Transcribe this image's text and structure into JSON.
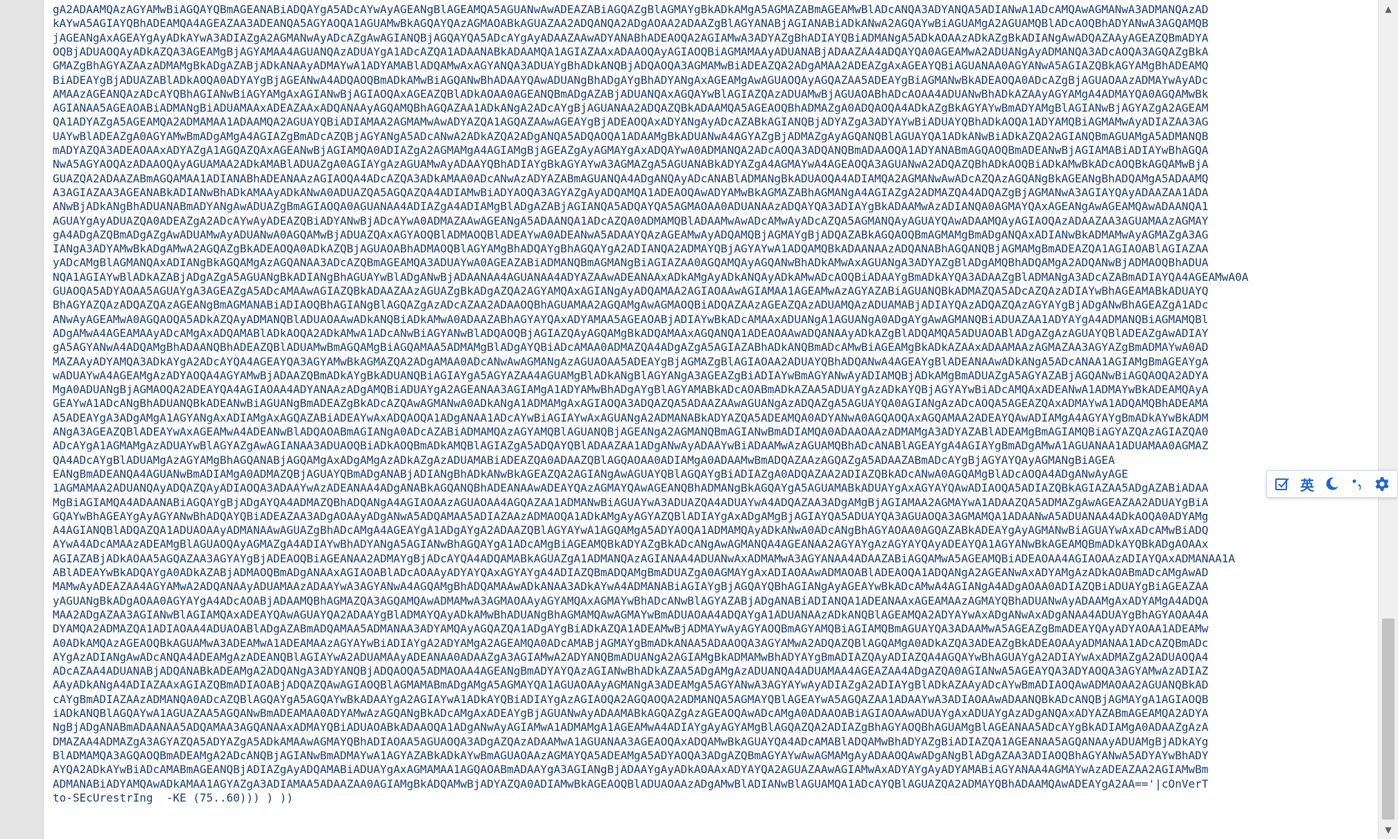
{
  "editor": {
    "lines": [
      "gA2ADAAMQAzAGYAMwBiAGQAYQBmAGEANABiADQAYgA5ADcAYwAyAGEANgBlAGEAMQA5AGUANwAwADEAZABiAGQAZgBlAGMAYgBkADkAMgA5AGMAZABmAGEAMwBlADcANQA3ADYANQA5ADIANwA1ADcAMQAwAGMANwA3ADMANQAzAD",
      "kAYwA5AGIAYQBhADEAMQA4AGEAZAA3ADEANQA5AGYAOQA1AGUAMwBkAGQAYQAzAGMAOABkAGUAZAA2ADQANQA2ADgAOAA2ADAAZgBlAGYANABjAGIANABiADkANwA2AGQAYwBiAGUAMgA2AGUAMQBlADcAOQBhADYANwA3AGQAMQB",
      "jAGEANgAxAGEAYgAyADkAYwA3ADIAZgA2AGMANwAyADcAZgAwAGIANQBjAGQAYQA5ADcAYgAyADAAZAAwADYANABhADEAOQA2AGIAMwA3ADYAZgBhADIAYQBiADMANgA5ADkAOAAzADkAZgBkADIANgAwADQAZAAyAGEAZQBmADYA",
      "OQBjADUAOQAyADkAZQA3AGEAMgBjAGYAMAA4AGUANQAzADUAYgA1ADcAZQA1ADAANABkADAAMQA1AGIAZAAxADAAOQAyAGIAOQBiAGMAMAAyADUANABjADAAZAA4ADQAYQA0AGEAMwA2ADUANgAyADMANQA3ADcAOQA3AGQAZgBkA",
      "GMAZgBhAGYAZAAzADMAMgBkADgAZABjADkANAAyADMAYwA1ADYAMABlADQAMwAxAGYANQA3ADUAYgBhADkANQBjADQAOQA3AGMAMwBiADEAZQA2ADgAMAA2ADEAZgAxAGEAYQBiAGUANAA0AGYANwA5AGIAZQBkAGYAMgBhADEAMQ",
      "BiADEAYgBjADUAZABlADkAOQA0ADYAYgBjAGEANwA4ADQAOQBmADkAMwBiAGQANwBhADAAYQAwADUANgBhADgAYgBhADYANgAxAGEAMgAwAGUAOQAyAGQAZAA5ADEAYgBiAGMANwBkADEAOQA0ADcAZgBjAGUAOAAzADMAYwAyADc",
      "AMAAzAGEANQAzADcAYQBhAGIANwBiAGYAMgAxAGIANwBjAGIAOQAxAGEAZQBlADkAOAA0AGEANQBmADgAZABjADUANQAxAGQAYwBlAGIAZQAzADUAMwBjAGUAOABhADcAOAA4ADUANwBhADkAZAAyAGYAMgA4ADMAYQA0AGQAMwBk",
      "AGIANAA5AGEAOABiADMANgBiADUAMAAxADEAZAAxADQANAAyAGQAMQBhAGQAZAA1ADkANgA2ADcAYgBjAGUANAA2ADQAZQBkADAAMQA5AGEAOQBhADMAZgA0ADQAOQA4ADkAZgBkAGYAYwBmADYAMgBlAGIANwBjAGYAZgA2AGEAM",
      "QA1ADYAZgA5AGEAMQA2ADMAMAA1ADAAMQA2AGUAYQBiADIAMAA2AGMAMwAwADYAZQA1AGQAZAAwAGEAYgBjADEAOQAxADYANgAyADcAZABkAGIANQBjADYAZgA3ADYAYwBiADUAYQBhADkAOQA1ADYAMQBiAGMAMwAyADIAZAA3AG",
      "UAYwBlADEAZgA0AGYAMwBmADgAMgA4AGIAZgBmADcAZQBjAGYANgA5ADcANwA2ADkAZQA2ADgANQA5ADQAOQA1ADAAMgBkADUANwA4AGYAZgBjADMAZgAyAGQANQBlAGUAYQA1ADkANwBiADkAZQA2AGIANQBmAGUAMgA5ADMANQB",
      "mADYAZQA3ADEAOAAxADYAZgA1AGQAZQAxAGEANwBjAGIAMQA0ADIAZgA2AGMAMgA4AGIAMgBjAGEAZgAyAGMAYgAxADQAYwA0ADMANQA2ADcAOQA3ADQANQBmADAAOQA1ADYANABmAGQAOQBmADEANwBjAGIAMABiADIAYwBhAGQA",
      "NwA5AGYAOQAzADAAOQAyAGUAMAA2ADkAMABlADUAZgA0AGIAYgAzAGUAMwAyADAAYQBhADIAYgBkAGYAYwA3AGMAZgA5AGUANABkADYAZgA4AGMAYwA4AGEAOQA3AGUANwA2ADQAZQBhADkAOQBiADkAMwBkADcAOQBkAGQAMwBjA",
      "GUAZQA2ADAAZABmAGQAMAA1ADIANABhADEANAAzAGIAOQA4ADcAZQA3ADkAMAA0ADcANwAzADYAZABmAGUANQA4ADgANQAyADcANABlADMANgBkADUAOQA4ADIAMQA2AGMANwAwADcAZQAzAGQANgBkAGEANgBhADQAMgA5ADAAMQ",
      "A3AGIAZAA3AGEANABkADIANwBhADkAMAAyADkANwA0ADUAZQA5AGQAZQA4ADIAMwBiADYAOQA3AGYAZgAyADQAMQA1ADEAOQAwADYAMwBkAGMAZABhAGMANgA4AGIAZgA2ADMAZQA4ADQAZgBjAGMANwA3AGIAYQAyADAAZAA1ADA",
      "ANwBjADkANgBhADUANABmADYANgAwADUAZgBmAGIAOQA0AGUANAA4ADIAZgA4ADIAMgBlADgAZABjAGIANQA5ADQAYQA5AGMAOAA0ADUANAAzADQAYQA3ADIAYgBkADAAMwAzADIANQA0AGMAYQAxAGEANgAwAGEAMQAwADAANQA1",
      "AGUAYgAyADUAZQA0ADEAZgA2ADcAYwAyADEAZQBiADYANwBjADcAYwA0ADMAZAAwAGEANgA5ADAANQA1ADcAZQA0ADMAMQBlADAAMwAwADcAMwAyADcAZQA5AGMANQAyAGUAYQAwADAAMQAyAGIAOQAzADAAZAA3AGUAMAAzAGMAY",
      "gA4ADgAZQBmADgAZgAwADUAMwAyADUANwA0AGQAMwBjADUAZQAxAGYAOQBlADMAOQBlADEAYwA0ADEANwA5ADAAYQAzAGEAMwAyADQAMQBjAGMAYgBjADQAZABkAGQAOQBmAGMAMgBmADgANQAxADIANwBkADMAMwAyAGMAZgA3AG",
      "IANgA3ADYAMwBkADgAMwA2AGQAZgBkADEAOQA0ADkAZQBjAGUAOABhADMAOQBlAGYAMgBhADQAYgBhAGQAYgA2ADIANQA2ADMAYQBjAGYAYwA1ADQAMQBkADAANAAzADQANABhAGQANQBjAGMAMgBmADEAZQA1AGIAOABlAGIAZAA",
      "yADcAMgBlAGMANQAxADIANgBkAGQAMgAzAGQANAA3ADcAZQBmAGEAMQA3ADUAYwA0AGEAZABiADMANQBmAGMANgBiAGIAZAA0AGQAMQAyAGQANwBhADkAMwAxAGUANgA3ADYAZgBlADgAMQBhADQAMgA2ADQANwBjADMAOQBhADUA",
      "NQA1AGIAYwBlADkAZABjADgAZgA5AGUANgBkADIANgBhAGUAYwBlADgANwBjADAANAA4AGUANAA4ADYAZAAwADEANAAxADkAMgAyADkANQAyADkAMwADcAOQBiADAAYgBmADkAYQA3ADAAZgBlADMANgA3ADcAZABmADIAYQA4AGEAMwA0A",
      "GUAOQA5ADYAOAA5AGUAYgA3AGEAZgA5ADcAMAAwAGIAZQBkADAAZAAzAGUAZgBkADgAZQA2AGYAMQAxAGIANgAyADQAMAA2AGIAOAAwAGIAMAA1AGEAMwAzAGYAZABiAGUANQBkADMAZQA5ADcAZQAzADIAYwBhAGEAMABkADUAYQ",
      "BhAGYAZQAzADQAZQAzAGEANgBmAGMANABiADIAOQBhAGIANgBlAGQAZgAzADcAZAA2ADAAOQBhAGUAMAA2AGQAMgAwAGMAOQBiADQAZAAzAGEAZQAzADUAMQAzADUAMABjADIAYQAzADQAZQAzAGYAYgBjADgANwBhAGEAZgA1ADc",
      "ANwAyAGEAMwA0AGQAOQA5ADkAZQAyADMANQBlADUAOAAwADkANQBiADkAMwA0ADAAZABhAGYAYQAxADYAMAA5AGEAOABjADIAYwBkADcAMAAxADUANgA1AGUANgA0ADgAYgAwAGMANQBiADUAZAA1ADYAYgA4ADMANQBiAGMAMQBl",
      "ADgAMwA4AGEAMAAyADcAMgAxADQAMABlADkAOQA2ADkAMwA1ADcANwBiAGYANwBlADQAOQBjAGIAZQAyAGQAMgBkADQAMAAxAGQANQA1ADEAOAAwADQANAAyADkAZgBlADQAMQA5ADUAOABlADgAZgAzAGUAYQBlADEAZgAwADIAY",
      "gA5AGYANwA4ADQAMgBhADAANQBhADEAZQBlADUAMwBmAGQAMgBiAGQAMAA5ADMAMgBlADgAYQBiADcAMAA0ADMAZQA4ADgAZgA5AGIAZABhADkANQBmADcAMwBiAGEAMgBkADkAZAAxADAAMAAzAGMAZAA3AGYAZgBmADMAYwA0AD",
      "MAZAAyADYAMQA3ADkAYgA2ADcAYQA4AGEAYQA3AGYAMwBkAGMAZQA2ADgAMAA0ADcANwAwAGMANgAzAGUAOAA5ADEAYgBjAGMAZgBlAGIAOAA2ADUAYQBhADQANwA4AGEAYgBlADEANAAwADkANgA5ADcANAA1AGIAMgBmAGEAYgA",
      "wADUAYwA4AGEAMgAzADYAOQA4AGYAMwBjADAAZQBmADkAYgBkADUANQBiAGIAYgA5AGYAZAA4AGUAMgBlADkANgBlAGYANgA3AGEAZgBiADIAYwBmAGYANwAyADIAMQBjADkAMgBmADUAZgA5AGYAZABjAGQANwBiAGQAOQA2ADYA",
      "MgA0ADUANgBjAGMAOQA2ADEAYQA4AGIAOAA4ADYANAAzADgAMQBiADUAYgA2AGEANAA3AGIAMgA1ADYAMwBhADgAYgBlAGYAMABkADcAOABmADkAZAA5ADUAYgAzADkAYQBjAGYAYwBiADcAMQAxADEANwA1ADMAYwBkADEAMQAyA",
      "GEAYwA1ADcANgBhADUANQBkADEANwBiAGUANgBmADEAZgBkADcAZQAwAGMANwA0ADkANgA1ADMAMgAxAGIAOQA3ADQAZQA5ADAAZAAwAGUANgAzADQAZgA5AGUAYQA0AGIANgAzADcAOQA5AGEAZQAxADMAYwA1ADQAMQBhADEAMA",
      "A5ADEAYgA3ADgAMgA1AGYANgAxADIAMgAxAGQAZABiADEAYwAxADQAOQA1ADgANAA1ADcAYwBiAGIAYwAxAGUANgA2ADMANABkADYAZQA5ADEAMQA0ADYANwA0AGQAOQAxAGQAMAA2ADEAYQAwADIAMgA4AGYAYgBmADkAYwBkADM",
      "ANgA3AGEAZQBlADEAYwAxAGEAMwA4ADEANwBlADQAOABmAGIANgA0ADcAZABiADMAMQAzAGYAMQBlAGUANQBjAGEANgA2AGMANQBmAGIANwBmADIAMQA0ADAAOAAzADMAMgA3ADYAZABlADEAMgBmAGIAMQBiAGYAZQAzAGIAZQA0",
      "ADcAYgA1AGMAMgAzADUAYwBlAGYAZgAwAGIANAA3ADUAOQBiADkAOQBmADkAMQBlAGIAZgA5ADQAYQBlADAAZAA1ADgANwAyADAAYwBiADAAMwAzAGUAMQBhADcANABlAGEAYgA4AGIAYgBmADgAMwA1AGUANAA1ADUAMAA0AGMAZ",
      "QA4ADcAYgBlADUAMgAzAGYAMgBhAGQANABjAGQAMgAxADgAMgAzADkAZgAzADUAMABiADEAZQA0ADAAZQBlAGQAOAA0ADIAMgA0ADAAMwBmADQAZAAzAGQAZgA5ADAAZABmADcAYgBjAGYAYQAyAGMANgBiAGEA",
      "EANgBmADEANQA4AGUANwBmADIAMgA0ADMAZQBjAGUAYQBmADgANABjADIANgBhADkANwBkAGEAZQA2AGIANgAwAGUAYQBlAGQAYgBiADIAZgA0ADQAZAA2ADIAZQBkADcANwA0AGQAMgBlADcAOQA4ADgANwAyAGE",
      "1AGMAMAA2ADUANQAyADQAZQAyADIAOQA3ADAAYwAzADEANAA4ADgANABkAGQANQBhADEANAAwADEAYQAzAGMAYQAwAGEANQBhADMANgBkAGQAYgA5AGUAMABkADUAYgAxAGYAYQAwADIAOQA5ADIAZQBkAGIAZAA5ADgAZABiADAA",
      "MgBiAGIAMQA4ADAANABiAGQAYgBjADgAYQA4ADMAZQBhADQANgA4AGIAOAAzAGUAOAA4AGQAZAA1ADMANwBiAGUAYwA3ADUAZQA4ADUAYwA4ADQAZAA3ADgAMgBjAGIAMAA2AGMAYwA1ADAAZQA5ADMAZgAwAGEAZAA2ADUAYgBiA",
      "GQAYwBhAGEAYgAyAGYANwBhADQAYQBiADEAZAA3ADgAOAAyADgANwA5ADQAMAA5ADIAZAAzADMAOQA1ADkAMgAyAGYAZQBlADIAYgAxADgAMgBjAGIAYQA5ADUAYQA3AGUAOQA3AGMAMQA1ADAANwA5ADUANAA4ADkAOQA0ADYAMg",
      "A4AGIANQBlADQAZQA1ADUAOAAyADMANAAwAGUAZgBhADcAMgA4AGEAYgA1ADgAYgA2ADAAZQBlAGYAYwA1AGQAMgA5ADYAOQA1ADMAMQAyADkANwA0ADcANgBhAGYAOAA0AGQAZABkADEAYgAyAGMANwBiAGUAYwAxADcAMwBiADQ",
      "AYwA4ADcAMAAzADEAMgBlAGUAOQAyAGMAZgA4ADIAYwBhADYANgA5AGIANwBhAGQAYgA1ADcAMgBiAGEAMQBkADYAZgBkADcANgAwAGMANQA4AGEANAA2AGYAYgAzAGYAYQAyADEAYQA1AGYANwBkAGEAMQBmADkAYQBkADgAOAAx",
      "AGIAZABjADkAOAA5AGQAZAA3AGYAYgBjADEAOQBiAGEANAA2ADMAYgBjADcAYQA4ADQAMABkAGUAZgA1ADMANQAzAGIANAA4ADUANwAxADMAMwA3AGYANAA4ADAAZABiAGQAMwA5AGEAMQBiADEAOAA4AGIAOAAzADIAYQAxADMANAA1A",
      "ABlADEAYwBkADQAYgA0ADkAZABjADMAOQBmADgANAAxAGIAOABlADcAOAAyADYAYQAxAGYAYgA4ADIAZQBmADQAMgBmADUAZgA0AGMAYgAxADIAOAAwADMAOABlADEAOQA1ADQANgA2AGEANwAxADYAMgAzADkAOABmADcAMgAwAD",
      "MAMwAyADEAZAA4AGYAMwA2ADQANAAyADUAMAAzADAAYwA3AGYANwA4AGQAMgBhADQAMAAwADkANAA3ADkAYwA4ADMANABiAGIAYgBjAGQAYQBhAGIANgAyAGEAYwBkADcAMwA4AGIANgA4ADgAOAA0ADIAZQBiADUAYgBiAGEAZAA",
      "yAGUANgBkADgAOAA0AGYAYgA4ADcAOABjADAAMQBhAGMAZQA3AGQAMQAwADMAMwA3AGMAOAAyAGYAMQAxAGMAYwBhADcANwBlAGYAZABjADgANABiADIANQA1ADEANAAxAGEAMAAzAGMAYQBhADUANwAyADAAMgAxADYAMgA4ADQA",
      "MAA2ADgAZAA3AGIANwBlAGIAMQAxADEAYQAwAGUAYQA2ADAAYgBlADMAYQAyADkAMwBhADUANgBhAGMAMQAwAGMAYwBmADUAOAA4ADQAYgA1ADUANAAzADkANQBlAGEAMQA2ADYAYwAxADgANwAxADgANAA4ADUAYgBhAGYAOAA4A",
      "DYAMQA2ADMAZQA1ADIAOAA4ADUAOABlADgAZABmADQAMAA5ADMANAA3ADYAMQAyAGQAZQA1ADgAYgBiADkAZQA1ADEAMwBjADMAYwAyAGYAOQBmAGYAMQBiAGIAMQBmAGUAYQA3ADAAMwA5AGEAZgBmADEAYQAyADYAOAA1ADEAMw",
      "A0ADkAMQAzAGEAOQBkAGUAMwA3ADEAMwA1ADEAMAAzAGYAYwBiADIAYgA2ADYAMgA2AGEAMQA0ADcAMABjAGMAYgBmADkANAA5ADAAOQA3AGYAMwA2ADQAZQBlAGQAMgA0ADkAZQA3ADEAZgBkADEAOAAyADMANAA1ADcAZQBmADc",
      "AYgAzADIANgAwADcANQA4ADEAMgAzADEANQBlAGIAYwA2ADUAMAAyADEANAA0ADAAZgA3AGIAMwA2ADYANQBmADUANgA2AGIAMgBkADMAMwBhADYAYgBmADIAZQAyADIAZQA4AGQAYwBhAGUAYgA2ADIAYwAxADMAZgA2ADUAOQA4",
      "ADcAZAA4ADUANABjADQANABkADEAMgA2ADQANgA3ADYANQBjADQAOQA5ADMAOAA4AGEANgBmADYAYQAzAGIANwBhADkAZAA5ADgAMgAzADUANQA4ADUAMAA4AGEAZAA4ADgAZQA0AGIANwA5AGEAYQA3ADYAOQA3AGYAMwAzADIAZ",
      "AAyADkANgA4ADIAZAAxAGIAZQBmADIAOABjADQAZQAwAGIAOQBlAGMAMABmADgAMgA5AGMAYQA1AGUAOAAyAGMANgA3ADEAMgA5AGYANwA3AGYAYwAyADIAZgA2ADIAYgBlADkAZAAyADcAYwBmADIAOQAwADMAOAA2AGUANQBkAD",
      "cAYgBmADIAZAAzADMANQA0ADcAZQBlAGQAYgA5AGQAYwBkADAAYgA2AGIAYwA1ADkAYQBiADIAYgAzAGIAOQA2AGQAOQA2ADMANQA5AGMAYQBlAGEAYwA5AGQAZAA1ADAAYwA3ADIAOAAwADAANQBkADcANQBjAGMAYgA1AGIAOQB",
      "iADkANQBlAGQAYwA1AGUAZAA5AGQANwBmADEAMAA0ADYAMwAzAGQANgBkADcAMgAxADEAYgBjAGUANwAyADAAMABkAGQAZgAzAGEAOQAwADcAMgA0ADAAOABiAGIAOAAwADUAYgAxADUAYgAzADgANQAxADYAZABmAGEAMQA2ADYA",
      "NgBjADgANABmADAANAA5ADQAMAA3AGQANAAxADMAYQBiADUAOABkADAAOQA1ADgANwAyAGIAMwA1ADMAMgA1AGEAMwA4ADIAYgAyAGYAMgBlAGQAZQA2ADIAZgBhAGYAOQBhAGUAMgBlAGEANAA5ADcAYgBkADIAMgA0ADAAZgAzA",
      "DMAZAA4ADMAZgA3AGYAZQA5ADYAZgA5ADkAMAAwAGMAYQBhADIAOAA5AGUAOQA3ADgAZQAzADAAMwA1AGUANAA3AGEAOQAxADQAMwBkAGUAYQA4ADcAMABlADQAMwBhADYAZgBiADIAZQA1AGEANAA5AGQANAAyADUAMgBjADkAYg",
      "BlADMAMQA3AGQAOQBmADEAMgA2ADcANQBjAGIANwBmADMAYwA1AGYAZABkADkAYwBmAGUAOAAzAGMAYQA5ADEAMgA5ADYAOQA3ADgAZQBmAGYAYwAwAGMAMgAyADAAOQAwADgANgBlADgAZAA3ADIAOQBhAGYANwA5ADYAYwBhADY",
      "AYQA2ADkAYwBiADcAMABmAGEANQBjADIAZgAyADQAMABiADUAYgAxAGMAMAA1AGQAOABmADAAYgA3AGIANgBjADAAYgAyADkAOAAxADYAYQA2AGUAZAAwAGIAMwAxADYAYgAyADYAMABiAGYANAA4AGMAYwAzADEAZAA2AGIAMwBm",
      "ADMANABiADYAMQAwADkAMAA1AGYAZgA3ADIAMAA5ADAAZAA0AGIAMgBkADQAMwBjADYAZQA0ADIAMwBkAGEAOQBlADUAOAAzADgAMwBlADIANwBlAGUAMQA1ADcAYQBlAGUAZQA2ADMAYQBhADAAMQAwADEAYgA2AA=='|cOnVerT",
      "to-SEcUrestrIng  -KE (75..60))) ) ))"
    ]
  },
  "ime_toolbar": {
    "language_label": "英"
  },
  "colors": {
    "code_text": "#1a3c6e",
    "ime_accent": "#1e64d2",
    "gutter": "#e4e4e4"
  }
}
